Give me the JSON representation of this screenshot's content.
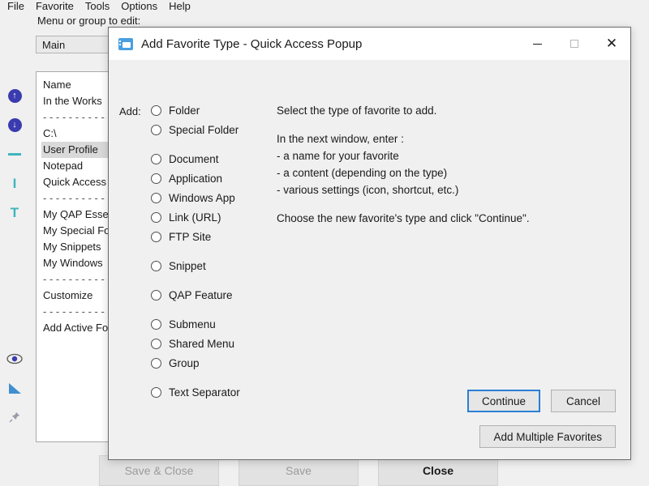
{
  "app": {
    "menubar": [
      {
        "label": "File"
      },
      {
        "label": "Favorite"
      },
      {
        "label": "Tools"
      },
      {
        "label": "Options"
      },
      {
        "label": "Help"
      }
    ],
    "menu_group_label": "Menu or group to edit:",
    "menu_group_value": "Main",
    "toolbar": [
      {
        "name": "move-up-icon",
        "glyph": "↑"
      },
      {
        "name": "move-down-icon",
        "glyph": "↓"
      },
      {
        "name": "separator-icon",
        "glyph": ""
      },
      {
        "name": "vertical-line-icon",
        "glyph": "I"
      },
      {
        "name": "text-icon",
        "glyph": "T"
      },
      {
        "name": "preview-icon",
        "glyph": "◉"
      },
      {
        "name": "sort-icon",
        "glyph": ""
      },
      {
        "name": "pin-icon",
        "glyph": "📌"
      }
    ],
    "list": {
      "header": "Name",
      "rows": [
        {
          "label": "In the Works",
          "selected": false,
          "type": "item"
        },
        {
          "label": "- - - - - - - - - - - - - -",
          "selected": false,
          "type": "separator"
        },
        {
          "label": "C:\\",
          "selected": false,
          "type": "item"
        },
        {
          "label": "User Profile",
          "selected": true,
          "type": "item"
        },
        {
          "label": "Notepad",
          "selected": false,
          "type": "item"
        },
        {
          "label": "Quick Access",
          "selected": false,
          "type": "item"
        },
        {
          "label": "- - - - - - - - - - - - - -",
          "selected": false,
          "type": "separator"
        },
        {
          "label": "My QAP Essentials",
          "selected": false,
          "type": "item"
        },
        {
          "label": "My Special Folders",
          "selected": false,
          "type": "item"
        },
        {
          "label": "My Snippets",
          "selected": false,
          "type": "item"
        },
        {
          "label": "My Windows",
          "selected": false,
          "type": "item"
        },
        {
          "label": "- - - - - - - - - - - - - -",
          "selected": false,
          "type": "separator"
        },
        {
          "label": "Customize",
          "selected": false,
          "type": "item"
        },
        {
          "label": "- - - - - - - - - - - - - -",
          "selected": false,
          "type": "separator"
        },
        {
          "label": "Add Active Folder",
          "selected": false,
          "type": "item"
        }
      ]
    },
    "bottom_buttons": [
      {
        "label": "Save & Close",
        "name": "save-and-close-button",
        "disabled": true
      },
      {
        "label": "Save",
        "name": "save-button",
        "disabled": true
      },
      {
        "label": "Close",
        "name": "close-button",
        "disabled": false
      }
    ]
  },
  "dialog": {
    "title": "Add Favorite Type - Quick Access Popup",
    "title_icon": "window-card-icon",
    "window_controls": {
      "minimize": "–",
      "maximize": "□",
      "close": "✕"
    },
    "add_label": "Add:",
    "options": [
      {
        "label": "Folder",
        "gap_before": false
      },
      {
        "label": "Special Folder",
        "gap_before": false
      },
      {
        "label": "Document",
        "gap_before": true
      },
      {
        "label": "Application",
        "gap_before": false
      },
      {
        "label": "Windows App",
        "gap_before": false
      },
      {
        "label": "Link (URL)",
        "gap_before": false
      },
      {
        "label": "FTP Site",
        "gap_before": false
      },
      {
        "label": "Snippet",
        "gap_before": true
      },
      {
        "label": "QAP Feature",
        "gap_before": true
      },
      {
        "label": "Submenu",
        "gap_before": true
      },
      {
        "label": "Shared Menu",
        "gap_before": false
      },
      {
        "label": "Group",
        "gap_before": false
      },
      {
        "label": "Text Separator",
        "gap_before": true
      }
    ],
    "info_lines": [
      {
        "text": "Select the type of favorite to add.",
        "blank_after": true
      },
      {
        "text": "In the next window, enter :",
        "blank_after": false
      },
      {
        "text": "- a name for your favorite",
        "blank_after": false
      },
      {
        "text": "- a content (depending on the type)",
        "blank_after": false
      },
      {
        "text": "- various settings (icon, shortcut, etc.)",
        "blank_after": true
      },
      {
        "text": "Choose the new favorite's type and click \"Continue\".",
        "blank_after": false
      }
    ],
    "buttons": {
      "continue": "Continue",
      "cancel": "Cancel",
      "add_multiple": "Add Multiple Favorites"
    },
    "accent_focus_color": "#2a7fd4"
  }
}
